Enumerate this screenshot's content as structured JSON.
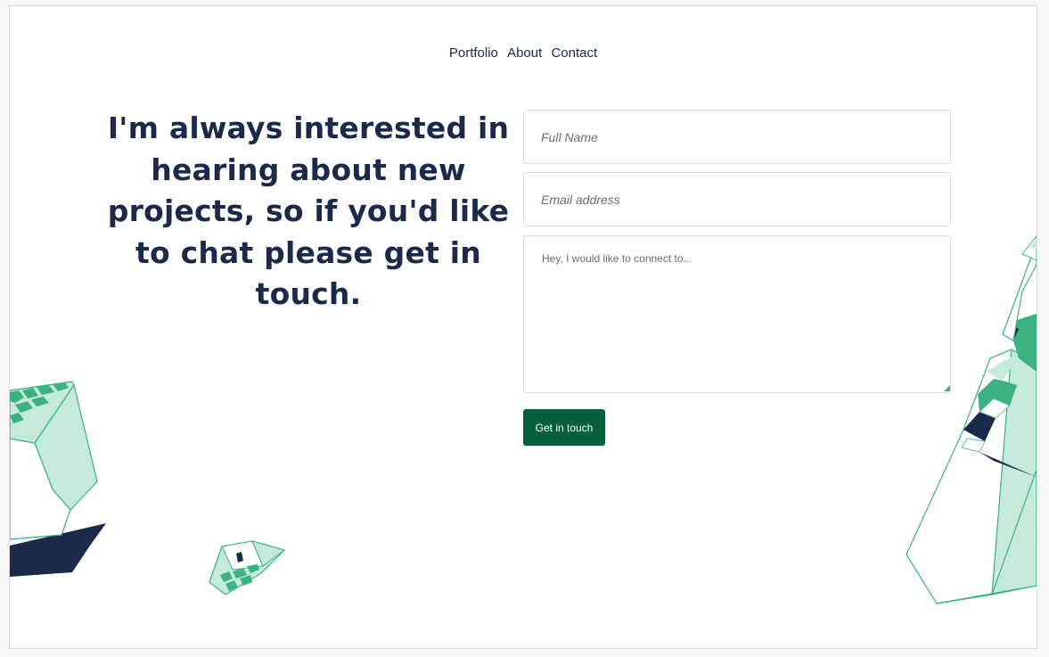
{
  "nav": {
    "items": [
      "Portfolio",
      "About",
      "Contact"
    ]
  },
  "hero": {
    "headline": "I'm always interested in hearing about new projects, so if you'd like to chat please get in touch."
  },
  "form": {
    "name_placeholder": "Full Name",
    "email_placeholder": "Email address",
    "message_placeholder": "Hey, I would like to connect to...",
    "submit_label": "Get in touch"
  },
  "colors": {
    "navy": "#1b2a4a",
    "green_dark": "#04603a",
    "green_mid": "#3bb27f",
    "green_light": "#c5e9da"
  }
}
